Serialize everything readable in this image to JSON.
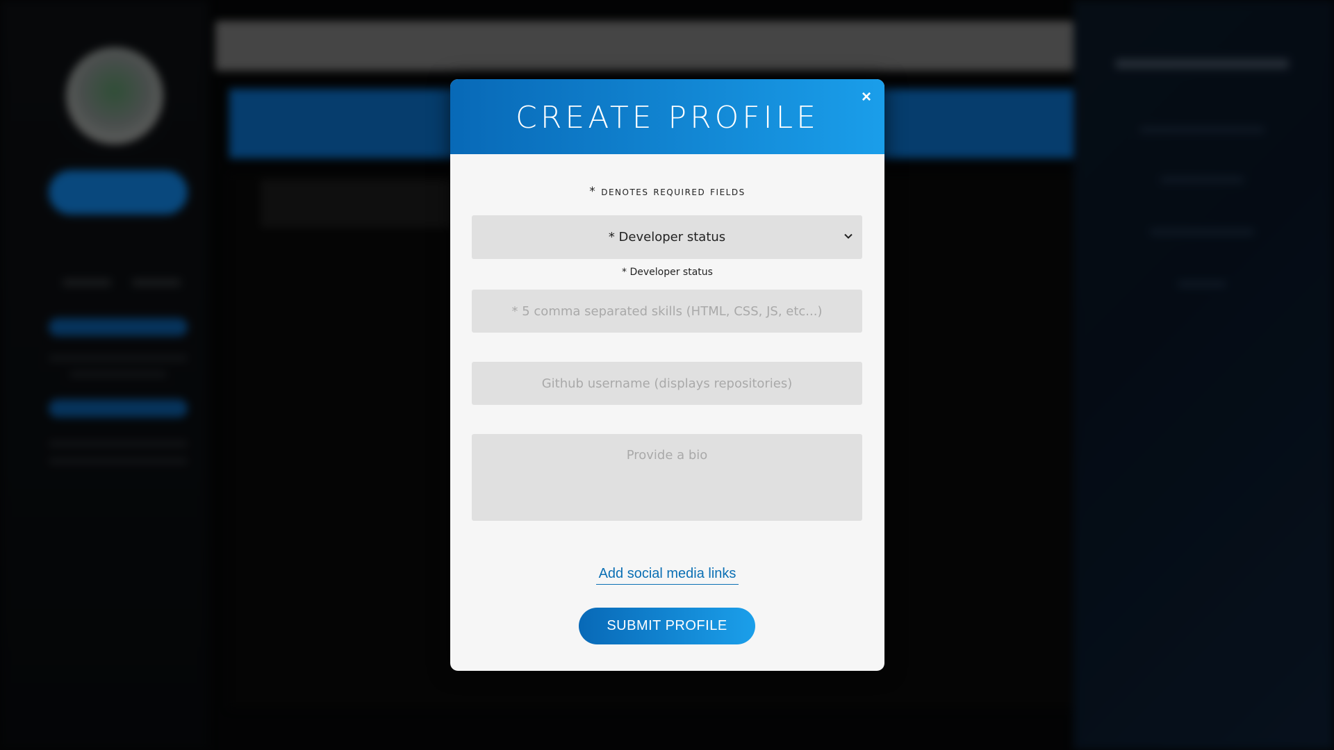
{
  "modal": {
    "title": "Create Profile",
    "close_label": "×",
    "required_note": "* denotes required fields",
    "developer_status": {
      "selected": "* Developer status",
      "caption": "* Developer status"
    },
    "skills": {
      "placeholder": "* 5 comma separated skills (HTML, CSS, JS, etc...)"
    },
    "github": {
      "placeholder": "Github username (displays repositories)"
    },
    "bio": {
      "placeholder": "Provide a bio"
    },
    "social_link_label": "Add social media links",
    "submit_label": "SUBMIT PROFILE"
  },
  "colors": {
    "accent_start": "#0869b7",
    "accent_end": "#1b9fea",
    "modal_bg": "#f6f6f6",
    "field_bg": "#e0e0e0"
  }
}
